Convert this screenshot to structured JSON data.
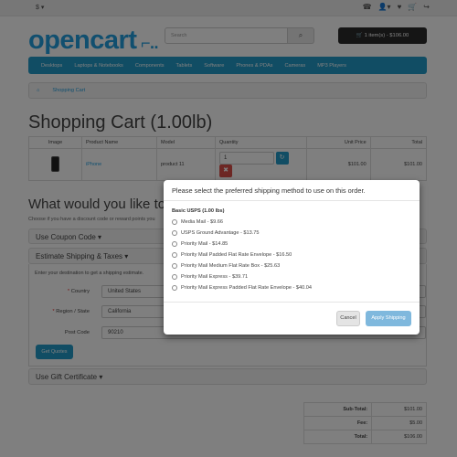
{
  "topbar": {
    "currency": "$ ▾",
    "icons": [
      "phone-icon",
      "user-icon",
      "heart-icon",
      "cart-icon",
      "share-icon"
    ]
  },
  "header": {
    "logo": "opencart",
    "search_placeholder": "Search",
    "cart_button": "1 item(s) - $106.00"
  },
  "menu": [
    "Desktops",
    "Laptops & Notebooks",
    "Components",
    "Tablets",
    "Software",
    "Phones & PDAs",
    "Cameras",
    "MP3 Players"
  ],
  "breadcrumb": {
    "current": "Shopping Cart"
  },
  "page_title": "Shopping Cart  (1.00lb)",
  "cart_table": {
    "headers": [
      "Image",
      "Product Name",
      "Model",
      "Quantity",
      "Unit Price",
      "Total"
    ],
    "row": {
      "name": "iPhone",
      "model": "product 11",
      "quantity": "1",
      "unit_price": "$101.00",
      "total": "$101.00"
    }
  },
  "next_section": {
    "title": "What would you like to do",
    "subtitle": "Choose if you have a discount code or reward points you"
  },
  "coupon_panel": "Use Coupon Code ▾",
  "shipping_panel": {
    "title": "Estimate Shipping & Taxes ▾",
    "hint": "Enter your destination to get a shipping estimate.",
    "country_label": "Country",
    "country_value": "United States",
    "region_label": "Region / State",
    "region_value": "California",
    "postcode_label": "Post Code",
    "postcode_value": "90210",
    "get_quotes": "Get Quotes"
  },
  "gift_panel": "Use Gift Certificate ▾",
  "totals": [
    {
      "label": "Sub-Total:",
      "value": "$101.00"
    },
    {
      "label": "Fee:",
      "value": "$5.00"
    },
    {
      "label": "Total:",
      "value": "$106.00"
    }
  ],
  "modal": {
    "title": "Please select the preferred shipping method to use on this order.",
    "group": "Basic USPS (1.00 lbs)",
    "options": [
      "Media Mail - $9.66",
      "USPS Ground Advantage - $13.75",
      "Priority Mail - $14.85",
      "Priority Mail Padded Flat Rate Envelope - $16.50",
      "Priority Mail Medium Flat Rate Box - $25.63",
      "Priority Mail Express - $39.71",
      "Priority Mail Express Padded Flat Rate Envelope - $40.04"
    ],
    "cancel": "Cancel",
    "apply": "Apply Shipping"
  },
  "colors": {
    "accent": "#229ac8",
    "logo": "#239fdf",
    "danger": "#da4f49",
    "dark": "#2a2a2a"
  }
}
